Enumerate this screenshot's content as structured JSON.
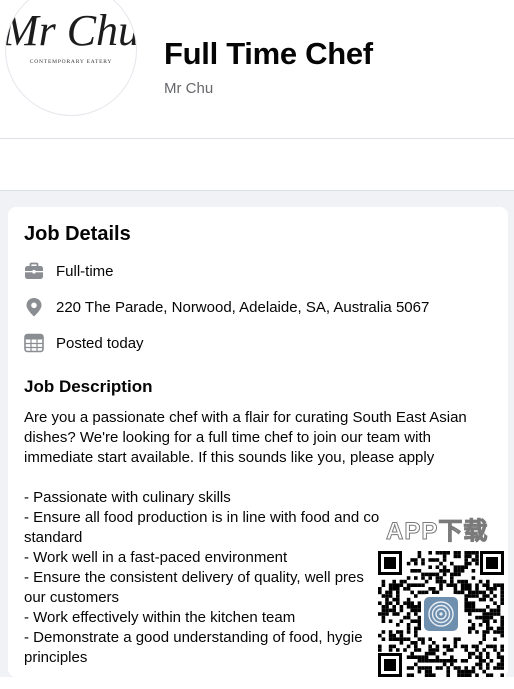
{
  "header": {
    "logo_script": "Mr Chu",
    "logo_tagline": "CONTEMPORARY EATERY",
    "job_title": "Full Time Chef",
    "company": "Mr Chu"
  },
  "job_details": {
    "title": "Job Details",
    "items": [
      {
        "icon": "briefcase-icon",
        "text": "Full-time"
      },
      {
        "icon": "location-pin-icon",
        "text": "220 The Parade, Norwood, Adelaide, SA, Australia 5067"
      },
      {
        "icon": "calendar-icon",
        "text": "Posted today"
      }
    ]
  },
  "job_description": {
    "title": "Job Description",
    "lines": [
      "Are you a passionate chef with a flair for curating South East Asian",
      "dishes? We're looking for a full time chef to join our team with",
      "immediate start available. If this sounds like you, please apply",
      "",
      "- Passionate with culinary skills",
      "- Ensure all food production is in line with food and co",
      "standard",
      "- Work well in a fast-paced environment",
      "- Ensure the consistent delivery of quality, well pres",
      "our customers",
      "- Work effectively within the kitchen team",
      "- Demonstrate a good understanding of food, hygie",
      "principles"
    ]
  },
  "overlay": {
    "label": "APP下载",
    "qr_icon": "fingerprint-icon"
  },
  "colors": {
    "page_bg": "#f0f2f5",
    "card_bg": "#ffffff",
    "secondary_text": "#65676b",
    "icon_gray": "#8a8d91"
  }
}
